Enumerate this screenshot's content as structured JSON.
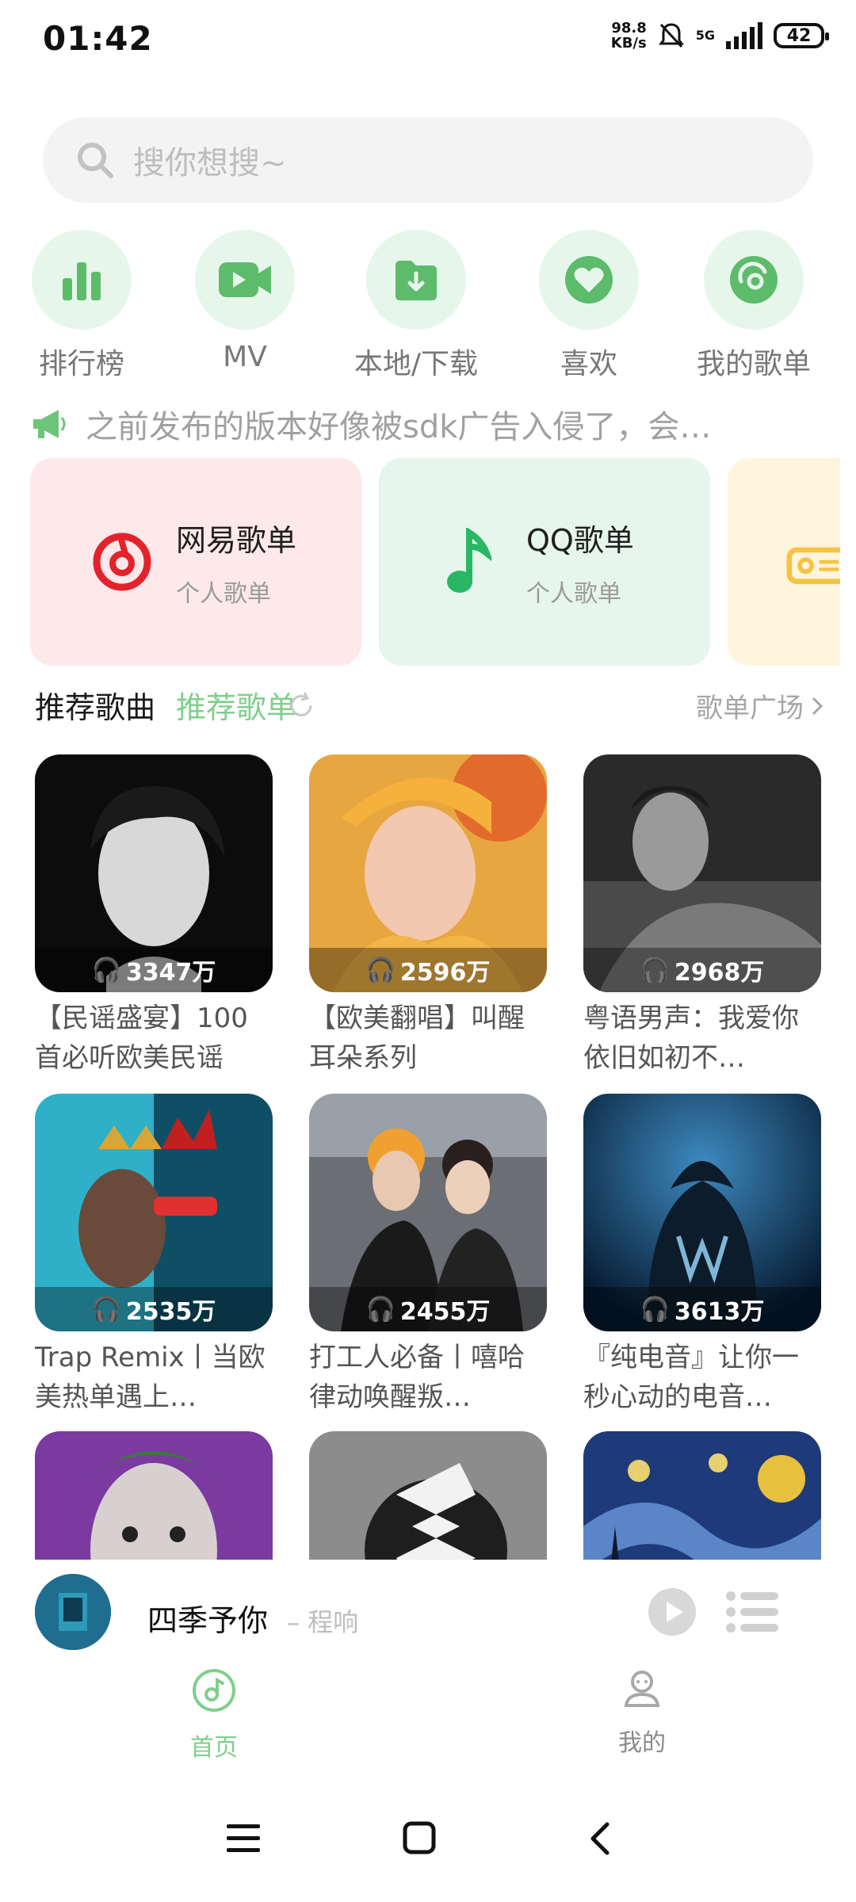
{
  "status": {
    "time": "01:42",
    "net_speed_value": "98.8",
    "net_speed_unit": "KB/s",
    "network": "5G",
    "battery": "42"
  },
  "search": {
    "placeholder": "搜你想搜~"
  },
  "quick_entries": [
    {
      "label": "排行榜",
      "icon": "chart-bars-icon"
    },
    {
      "label": "MV",
      "icon": "video-camera-icon"
    },
    {
      "label": "本地/下载",
      "icon": "download-folder-icon"
    },
    {
      "label": "喜欢",
      "icon": "heart-icon"
    },
    {
      "label": "我的歌单",
      "icon": "playlist-disc-icon"
    }
  ],
  "notice": {
    "text": "之前发布的版本好像被sdk广告入侵了，会…"
  },
  "source_cards": [
    {
      "title": "网易歌单",
      "subtitle": "个人歌单",
      "bg": "#fde8ea",
      "icon": "netease-logo-icon",
      "accent": "#e3232c"
    },
    {
      "title": "QQ歌单",
      "subtitle": "个人歌单",
      "bg": "#e6f6ec",
      "icon": "qq-music-note-icon",
      "accent": "#29b765"
    },
    {
      "title": "",
      "subtitle": "",
      "bg": "#fff4dc",
      "icon": "radio-icon",
      "accent": "#f5c445"
    }
  ],
  "tabs": {
    "songs": "推荐歌曲",
    "playlists": "推荐歌单",
    "square": "歌单广场"
  },
  "playlists": [
    {
      "count": "3347万",
      "title": "【民谣盛宴】100首必听欧美民谣"
    },
    {
      "count": "2596万",
      "title": "【欧美翻唱】叫醒耳朵系列"
    },
    {
      "count": "2968万",
      "title": "粤语男声：我爱你依旧如初不…"
    },
    {
      "count": "2535万",
      "title": "Trap Remix丨当欧美热单遇上…"
    },
    {
      "count": "2455万",
      "title": "打工人必备丨嘻哈律动唤醒叛…"
    },
    {
      "count": "3613万",
      "title": "『纯电音』让你一秒心动的电音…"
    },
    {
      "count": "",
      "title": ""
    },
    {
      "count": "",
      "title": ""
    },
    {
      "count": "",
      "title": ""
    }
  ],
  "player": {
    "song": "四季予你",
    "artist": "– 程响"
  },
  "nav": {
    "home": "首页",
    "mine": "我的"
  },
  "colors": {
    "accent_green": "#7fcf8b",
    "icon_green": "#5dbb6c"
  }
}
